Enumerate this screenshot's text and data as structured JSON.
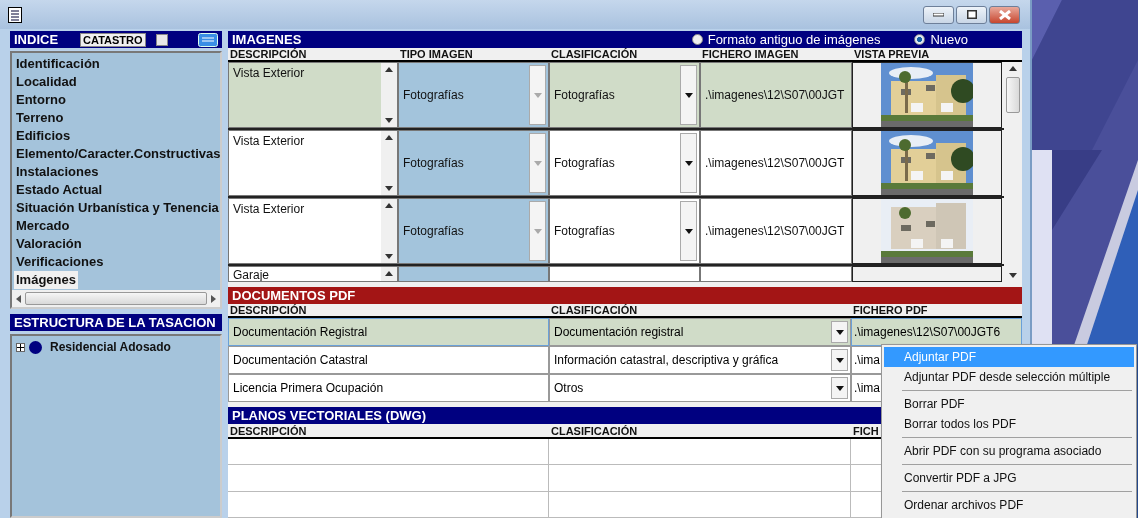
{
  "indice": {
    "title": "INDICE",
    "catastro_button": "CATASTRO",
    "catastro_checked": false,
    "items": [
      {
        "label": "Identificación",
        "selected": false
      },
      {
        "label": "Localidad",
        "selected": false
      },
      {
        "label": "Entorno",
        "selected": false
      },
      {
        "label": "Terreno",
        "selected": false
      },
      {
        "label": "Edificios",
        "selected": false
      },
      {
        "label": "Elemento/Caracter.Constructivas",
        "selected": false
      },
      {
        "label": "Instalaciones",
        "selected": false
      },
      {
        "label": "Estado Actual",
        "selected": false
      },
      {
        "label": "Situación Urbanística y Tenencia",
        "selected": false
      },
      {
        "label": "Mercado",
        "selected": false
      },
      {
        "label": "Valoración",
        "selected": false
      },
      {
        "label": "Verificaciones",
        "selected": false
      },
      {
        "label": "Imágenes",
        "selected": true
      }
    ]
  },
  "estructura": {
    "title": "ESTRUCTURA DE LA TASACION",
    "tree": [
      {
        "label": "Residencial Adosado",
        "expanded": false
      }
    ]
  },
  "imagenes": {
    "title": "IMAGENES",
    "format_options": [
      {
        "label": "Formato antiguo de imágenes",
        "selected": false
      },
      {
        "label": "Nuevo",
        "selected": true
      }
    ],
    "columns": [
      "DESCRIPCIÓN",
      "TIPO IMAGEN",
      "CLASIFICACIÓN",
      "FICHERO IMAGEN",
      "VISTA PREVIA"
    ],
    "rows": [
      {
        "descripcion": "Vista Exterior",
        "tipo": "Fotografías",
        "clasificacion": "Fotografías",
        "fichero": ".\\imagenes\\12\\S07\\00JGT",
        "selected": true
      },
      {
        "descripcion": "Vista Exterior",
        "tipo": "Fotografías",
        "clasificacion": "Fotografías",
        "fichero": ".\\imagenes\\12\\S07\\00JGT",
        "selected": false
      },
      {
        "descripcion": "Vista Exterior",
        "tipo": "Fotografías",
        "clasificacion": "Fotografías",
        "fichero": ".\\imagenes\\12\\S07\\00JGT",
        "selected": false
      },
      {
        "descripcion": "Garaje",
        "selected": false
      }
    ]
  },
  "documentos": {
    "title": "DOCUMENTOS PDF",
    "columns": [
      "DESCRIPCIÓN",
      "CLASIFICACIÓN",
      "FICHERO PDF"
    ],
    "rows": [
      {
        "descripcion": "Documentación Registral",
        "clasificacion": "Documentación registral",
        "fichero": ".\\imagenes\\12\\S07\\00JGT6",
        "selected": true
      },
      {
        "descripcion": "Documentación Catastral",
        "clasificacion": "Información catastral, descriptiva y gráfica",
        "fichero": ".\\ima",
        "selected": false
      },
      {
        "descripcion": "Licencia Primera Ocupación",
        "clasificacion": "Otros",
        "fichero": ".\\ima",
        "selected": false
      }
    ]
  },
  "planos": {
    "title": "PLANOS VECTORIALES (DWG)",
    "columns": [
      "DESCRIPCIÓN",
      "CLASIFICACIÓN",
      "FICH"
    ]
  },
  "context_menu": {
    "groups": [
      [
        {
          "label": "Adjuntar PDF",
          "selected": true
        },
        {
          "label": "Adjuntar PDF desde selección múltiple",
          "selected": false
        }
      ],
      [
        {
          "label": "Borrar PDF",
          "selected": false
        },
        {
          "label": "Borrar todos los PDF",
          "selected": false
        }
      ],
      [
        {
          "label": "Abrir PDF con su programa asociado",
          "selected": false
        }
      ],
      [
        {
          "label": "Convertir PDF a JPG",
          "selected": false
        }
      ],
      [
        {
          "label": "Ordenar archivos PDF",
          "selected": false
        }
      ]
    ]
  }
}
